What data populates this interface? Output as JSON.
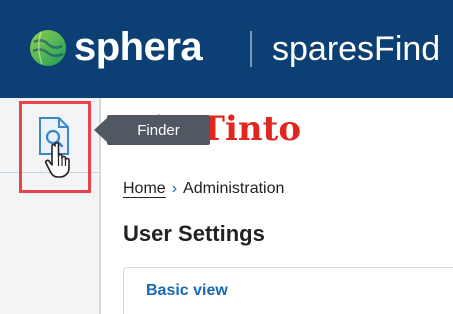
{
  "header": {
    "brand": "sphera",
    "app_name": "sparesFind",
    "bg_color": "#0c3f73"
  },
  "sidebar": {
    "finder_icon": "search-document-icon",
    "tooltip": "Finder",
    "highlight_color": "#e8424a"
  },
  "client_logo": "Rio Tinto",
  "breadcrumb": {
    "home": "Home",
    "separator_icon": "chevron-right-icon",
    "current": "Administration"
  },
  "page": {
    "title": "User Settings",
    "tab_label": "Basic view",
    "accent_color": "#1a67b3"
  }
}
